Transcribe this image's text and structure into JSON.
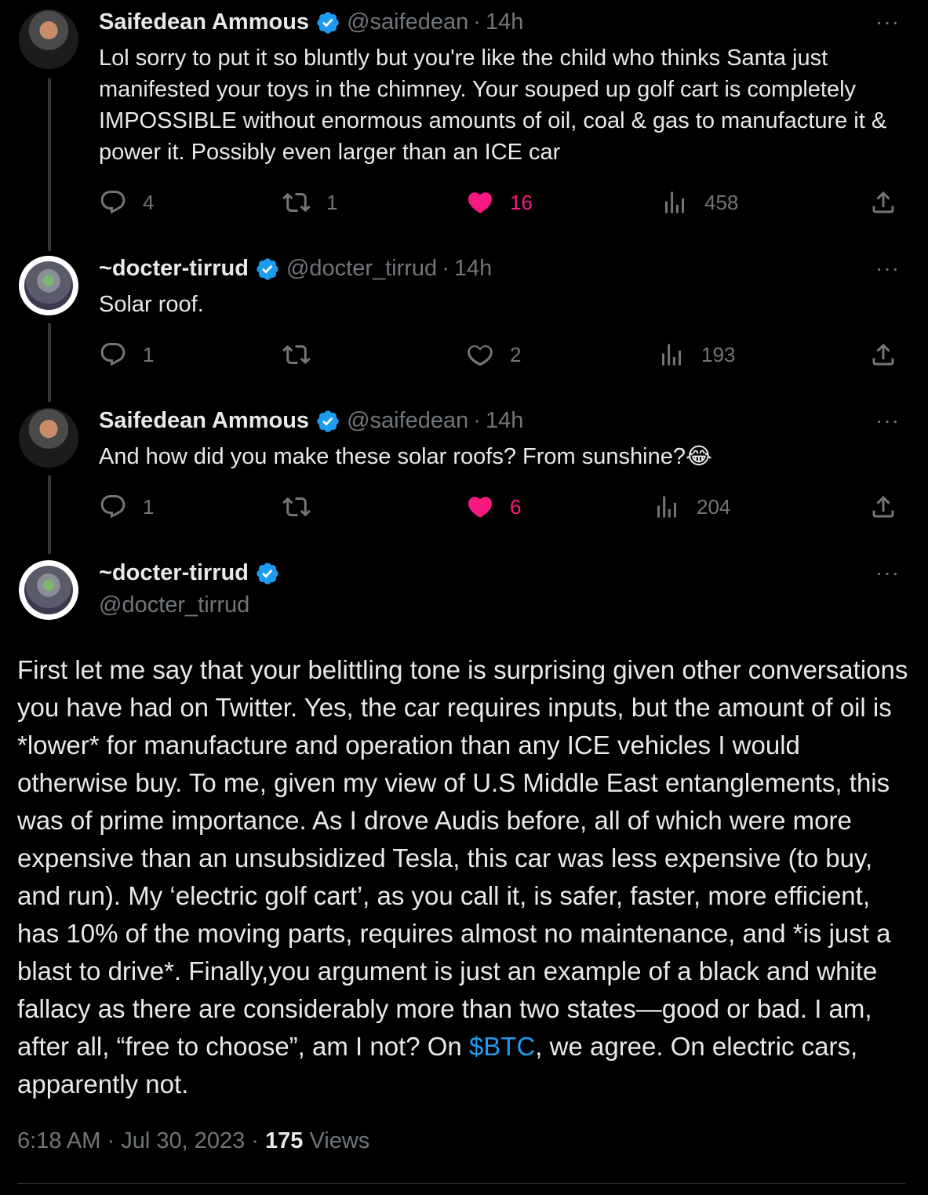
{
  "tweets": [
    {
      "name": "Saifedean Ammous",
      "handle": "@saifedean",
      "sep": "·",
      "time": "14h",
      "text": "Lol sorry to put it so bluntly but you're like the child who thinks Santa just manifested your toys in the chimney. Your souped up golf cart is completely IMPOSSIBLE without enormous amounts of oil, coal & gas to manufacture it & power it. Possibly even larger than an ICE car",
      "replies": "4",
      "retweets": "1",
      "likes": "16",
      "views": "458",
      "liked": true
    },
    {
      "name": "~docter-tirrud",
      "handle": "@docter_tirrud",
      "sep": "·",
      "time": "14h",
      "text": "Solar roof.",
      "replies": "1",
      "retweets": "",
      "likes": "2",
      "views": "193",
      "liked": false
    },
    {
      "name": "Saifedean Ammous",
      "handle": "@saifedean",
      "sep": "·",
      "time": "14h",
      "text": "And how did you make these solar roofs? From sunshine?😂",
      "replies": "1",
      "retweets": "",
      "likes": "6",
      "views": "204",
      "liked": true
    }
  ],
  "main": {
    "name": "~docter-tirrud",
    "handle": "@docter_tirrud",
    "text_before": "First let me say that your belittling tone is surprising given other conversations you have had on Twitter. Yes, the car requires inputs, but the amount of oil is *lower* for manufacture and operation than any ICE vehicles I would otherwise buy.  To me, given my view of U.S Middle East entanglements, this was of prime importance. As I drove Audis before, all of which were more expensive than an unsubsidized Tesla, this car was less expensive (to buy, and run). My ‘electric golf cart’, as you call it, is safer, faster, more efficient, has 10% of the moving parts, requires almost no maintenance, and *is just a blast to drive*. Finally,you argument is just an example of a black and white fallacy as there are considerably more than two states—good or bad. I am, after all, “free to choose”, am I not?  On ",
    "cashtag": "$BTC",
    "text_after": ", we agree. On electric cars, apparently not.",
    "time": "6:18 AM",
    "date": "Jul 30, 2023",
    "views_count": "175",
    "views_label": "Views"
  },
  "more_label": "···",
  "meta_sep": "·",
  "colors": {
    "accent": "#1d9bf0",
    "like": "#f91880",
    "muted": "#71767b",
    "text": "#e7e9ea",
    "bg": "#000000"
  },
  "icons": [
    "reply-icon",
    "retweet-icon",
    "like-icon",
    "views-icon",
    "share-icon",
    "verified-badge-icon"
  ]
}
